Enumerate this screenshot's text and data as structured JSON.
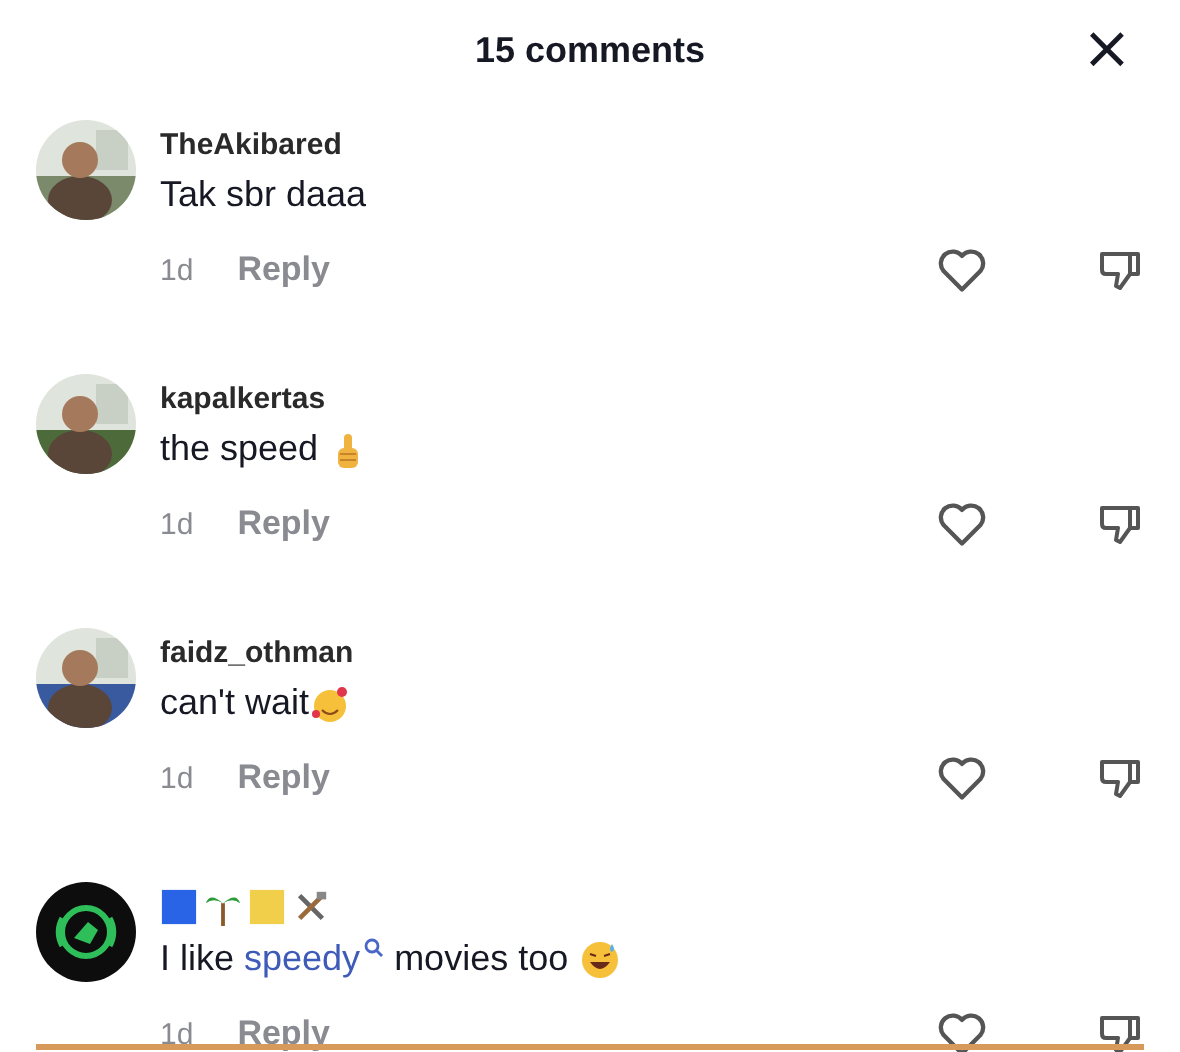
{
  "header": {
    "title": "15 comments",
    "close": "×"
  },
  "comments": [
    {
      "username": "TheAkibared",
      "body": [
        {
          "kind": "text",
          "text": "Tak sbr daaa"
        }
      ],
      "time": "1d",
      "reply": "Reply"
    },
    {
      "username": "kapalkertas",
      "body": [
        {
          "kind": "text",
          "text": "the speed "
        },
        {
          "kind": "emoji"
        }
      ],
      "time": "1d",
      "reply": "Reply"
    },
    {
      "username": "faidz_othman",
      "body": [
        {
          "kind": "text",
          "text": "can't wait"
        },
        {
          "kind": "emoji"
        }
      ],
      "time": "1d",
      "reply": "Reply"
    },
    {
      "body": [
        {
          "kind": "text",
          "text": "I like "
        },
        {
          "kind": "link",
          "text": "speedy"
        },
        {
          "kind": "text",
          "text": " movies too "
        },
        {
          "kind": "emoji"
        }
      ],
      "time": "1d",
      "reply": "Reply"
    }
  ]
}
